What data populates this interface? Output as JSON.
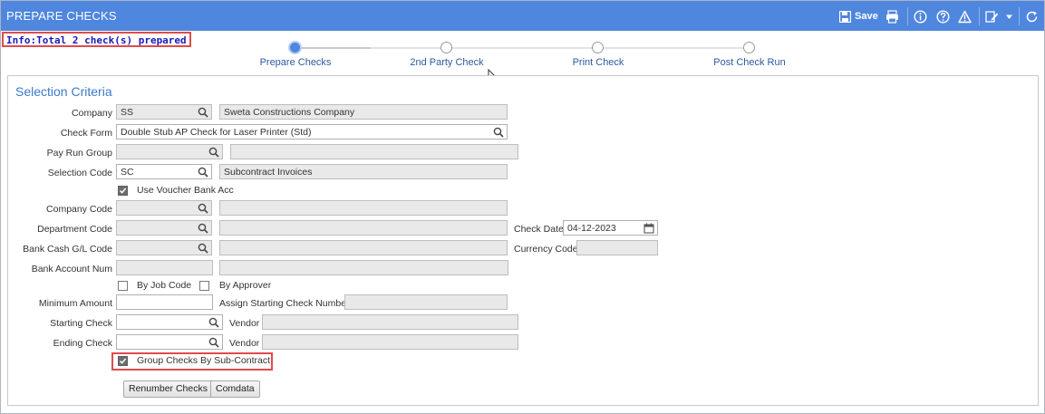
{
  "window": {
    "title": "PREPARE CHECKS"
  },
  "toolbar": {
    "save_label": "Save",
    "icons": [
      "save-icon",
      "print-icon",
      "info-icon",
      "help-icon",
      "warning-icon",
      "edit-icon",
      "dropdown-icon",
      "refresh-icon"
    ]
  },
  "info_message": "Info:Total 2 check(s) prepared",
  "stepper": {
    "steps": [
      {
        "label": "Prepare Checks",
        "active": true
      },
      {
        "label": "2nd Party Check",
        "active": false
      },
      {
        "label": "Print Check",
        "active": false
      },
      {
        "label": "Post Check Run",
        "active": false
      }
    ]
  },
  "panel": {
    "title": "Selection Criteria"
  },
  "form": {
    "company": {
      "label": "Company",
      "value": "SS",
      "description": "Sweta Constructions Company"
    },
    "check_form": {
      "label": "Check Form",
      "value": "Double Stub AP Check for Laser Printer (Std)"
    },
    "pay_run_group": {
      "label": "Pay Run Group",
      "value": "",
      "description": ""
    },
    "selection_code": {
      "label": "Selection Code",
      "value": "SC",
      "description": "Subcontract Invoices"
    },
    "use_voucher_bank_acc": {
      "label": "Use Voucher Bank Acc",
      "checked": true
    },
    "company_code": {
      "label": "Company Code",
      "value": "",
      "description": ""
    },
    "department_code": {
      "label": "Department Code",
      "value": "",
      "description": ""
    },
    "check_date": {
      "label": "Check Date",
      "value": "04-12-2023"
    },
    "bank_cash_gl_code": {
      "label": "Bank Cash G/L Code",
      "value": "",
      "description": ""
    },
    "currency_code": {
      "label": "Currency Code",
      "value": ""
    },
    "bank_account_num": {
      "label": "Bank Account Num",
      "value": "",
      "description": ""
    },
    "by_job_code": {
      "label": "By Job Code",
      "checked": false
    },
    "by_approver": {
      "label": "By Approver",
      "checked": false
    },
    "minimum_amount": {
      "label": "Minimum Amount",
      "value": ""
    },
    "assign_starting_check_number": {
      "label": "Assign Starting Check Number",
      "value": ""
    },
    "starting_check": {
      "label": "Starting Check",
      "value": ""
    },
    "starting_vendor": {
      "label": "Vendor",
      "value": ""
    },
    "ending_check": {
      "label": "Ending Check",
      "value": ""
    },
    "ending_vendor": {
      "label": "Vendor",
      "value": ""
    },
    "group_checks_by_subcontract": {
      "label": "Group Checks By Sub-Contract",
      "checked": true
    }
  },
  "buttons": {
    "renumber_checks": "Renumber Checks",
    "comdata": "Comdata"
  },
  "colors": {
    "titlebar": "#4f86de",
    "accent": "#3d79c9",
    "highlight": "#e04b4b",
    "info_text": "#1b1bb6"
  }
}
